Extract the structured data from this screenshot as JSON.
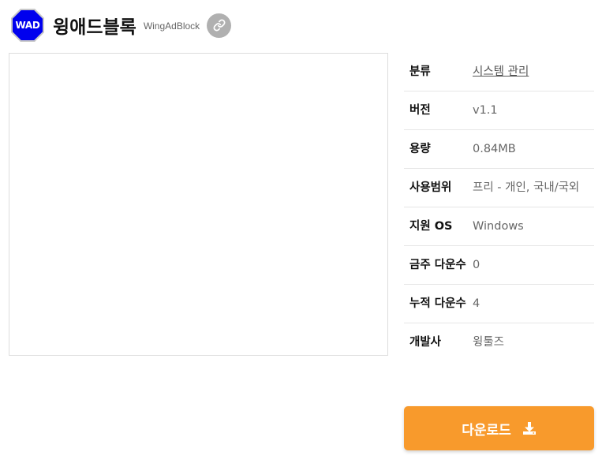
{
  "app": {
    "logo_text": "WAD",
    "title": "윙애드블록",
    "subtitle": "WingAdBlock",
    "icons": {
      "logo": "stop-sign-logo",
      "link": "link-icon",
      "download": "download-icon"
    },
    "colors": {
      "logo": "#0000ee",
      "download_button": "#f89a2c",
      "link_button": "#b0b0b0"
    }
  },
  "info": [
    {
      "label": "분류",
      "value": "시스템 관리"
    },
    {
      "label": "버전",
      "value": "v1.1"
    },
    {
      "label": "용량",
      "value": "0.84MB"
    },
    {
      "label": "사용범위",
      "value": "프리 - 개인, 국내/국외"
    },
    {
      "label": "지원 OS",
      "value": "Windows"
    },
    {
      "label": "금주 다운수",
      "value": "0"
    },
    {
      "label": "누적 다운수",
      "value": "4"
    },
    {
      "label": "개발사",
      "value": "윙툴즈"
    }
  ],
  "download": {
    "label": "다운로드"
  }
}
